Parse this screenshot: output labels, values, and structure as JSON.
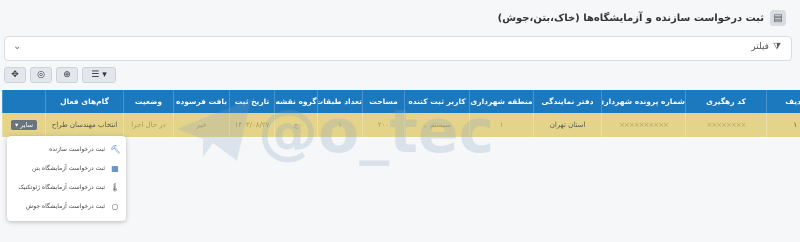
{
  "page": {
    "title": "ثبت درخواست سازنده و آزمایشگاه‌ها (خاک،بتن،جوش)"
  },
  "filter": {
    "label": "فیلتر"
  },
  "toolbar": {
    "icons": [
      "move-icon",
      "zoom-icon",
      "view-icon",
      "columns-menu-icon"
    ]
  },
  "table": {
    "columns": [
      "ردیف",
      "کد رهگیری",
      "شماره پرونده شهرداری",
      "دفتر نمایندگی",
      "منطقه شهرداری",
      "کاربر ثبت کننده",
      "مساحت",
      "تعداد طبقات",
      "گروه نقشه",
      "تاریخ ثبت",
      "بافت فرسوده",
      "وضعیت",
      "گام‌های فعال",
      ""
    ],
    "row": {
      "index": "۱",
      "tracking_code": "××××××××",
      "file_number": "××××××××××",
      "office": "استان تهران",
      "district": "۱",
      "user": "سیستم ..",
      "area": "۲۰۰",
      "floors": "۱",
      "map_group": "ج",
      "date": "۱۴۰۳/۰۸/۲۷",
      "worn_texture": "خیر",
      "status": "در حال اجرا",
      "active_steps": "انتخاب مهندسان طراح",
      "other_label": "سایر"
    }
  },
  "dropdown": {
    "items": [
      {
        "label": "ثبت درخواست سازنده",
        "icon": "hammer-icon"
      },
      {
        "label": "ثبت درخواست آزمایشگاه بتن",
        "icon": "bricks-icon"
      },
      {
        "label": "ثبت درخواست آزمایشگاه ژئوتکنیک",
        "icon": "thermometer-icon"
      },
      {
        "label": "ثبت درخواست آزمایشگاه جوش",
        "icon": "circle-icon"
      }
    ]
  },
  "watermark": {
    "text": "@o_tec"
  }
}
